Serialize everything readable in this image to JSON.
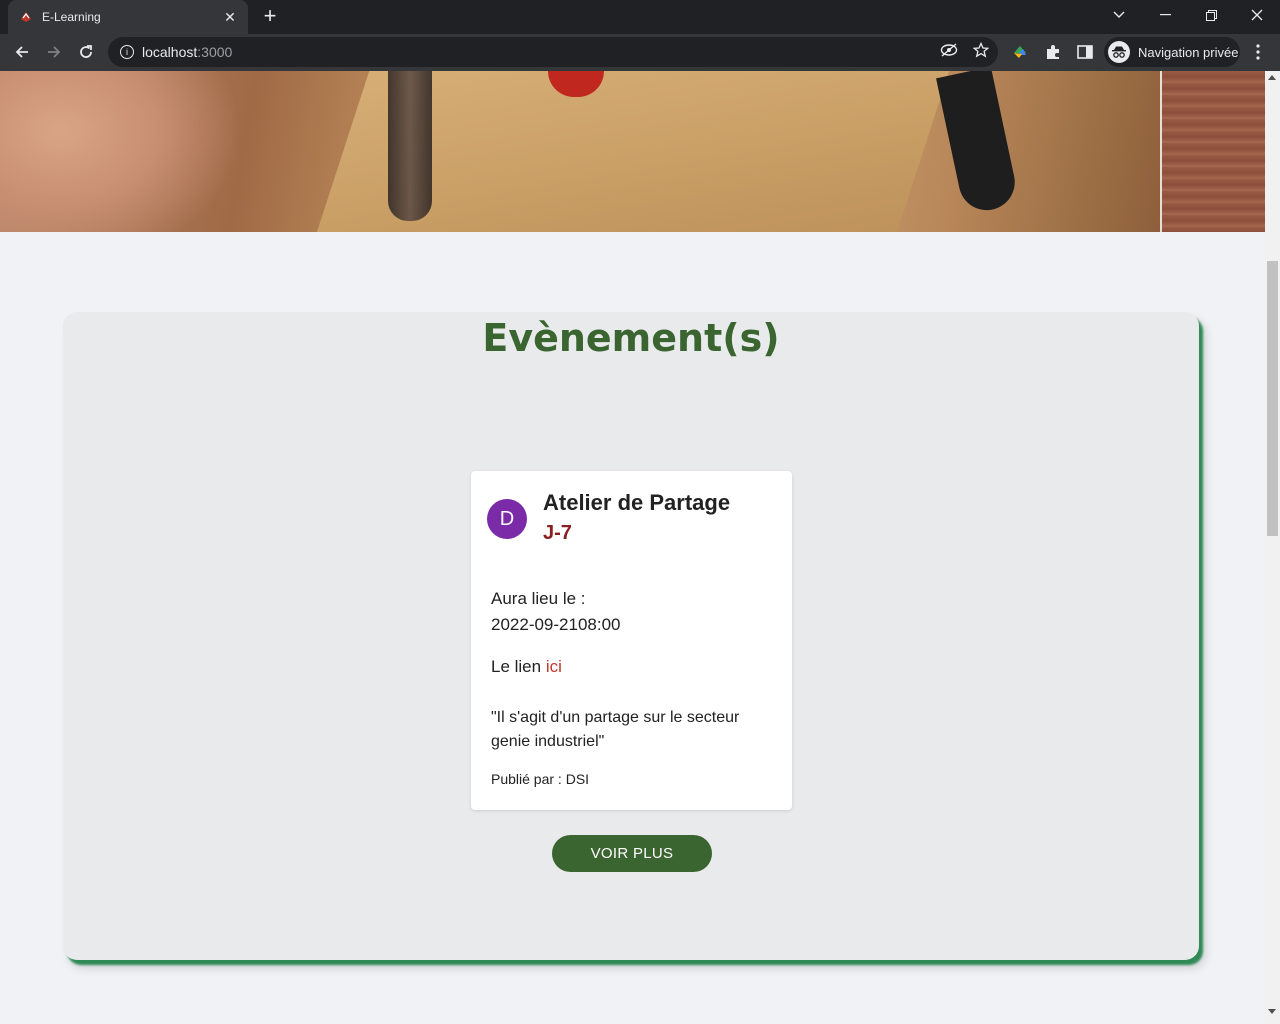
{
  "browser": {
    "tab_title": "E-Learning",
    "url_host": "localhost",
    "url_port": ":3000",
    "profile_label": "Navigation privée"
  },
  "events": {
    "heading": "Evènement(s)",
    "card": {
      "avatar_letter": "D",
      "title": "Atelier de Partage",
      "countdown": "J-7",
      "date_label": "Aura lieu le :",
      "date_value": "2022-09-2108:00",
      "link_prefix": "Le lien",
      "link_text": "ici",
      "description": "\"Il s'agit d'un partage sur le secteur genie industriel\"",
      "author": "Publié par : DSI"
    },
    "see_more_label": "VOIR PLUS"
  },
  "colors": {
    "heading": "#3b6530",
    "button": "#3b6530",
    "countdown": "#8a1f1f",
    "link": "#c0392b",
    "avatar": "#7b2aa8",
    "panel_shadow": "#2f8a57"
  },
  "icons": [
    "e-learning-favicon",
    "close-icon",
    "plus-icon",
    "chevron-down-icon",
    "minimize-icon",
    "restore-icon",
    "window-close-icon",
    "back-icon",
    "forward-icon",
    "reload-icon",
    "info-icon",
    "eye-off-icon",
    "star-icon",
    "extension-colorful-icon",
    "puzzle-icon",
    "sidebar-icon",
    "incognito-icon",
    "kebab-menu-icon"
  ]
}
